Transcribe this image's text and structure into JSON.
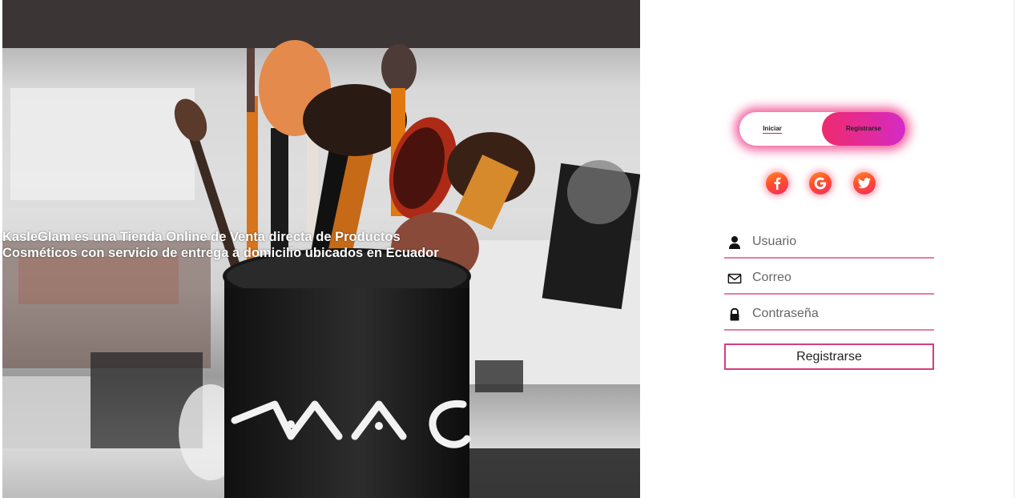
{
  "hero": {
    "line1": "KasleGlam es una Tienda Online de Venta directa de Productos",
    "line2": "Cosméticos con servicio de entrega a domicilio ubicados en Ecuador",
    "logo_text": "MAC"
  },
  "auth_toggle": {
    "login_label": "Iniciar",
    "register_label": "Registrarse",
    "active": "register"
  },
  "socials": [
    {
      "name": "facebook",
      "icon": "facebook-icon"
    },
    {
      "name": "google",
      "icon": "google-icon"
    },
    {
      "name": "twitter",
      "icon": "twitter-icon"
    }
  ],
  "form": {
    "username_placeholder": "Usuario",
    "email_placeholder": "Correo",
    "password_placeholder": "Contraseña",
    "submit_label": "Registrarse"
  },
  "colors": {
    "accent": "#e0107a",
    "toggle_gradient_start": "#ee2b6f",
    "toggle_gradient_end": "#d32bc7",
    "field_underline": "#e87aa6",
    "social_gradient_start": "#ff8a2a",
    "social_gradient_end": "#f22f63"
  }
}
